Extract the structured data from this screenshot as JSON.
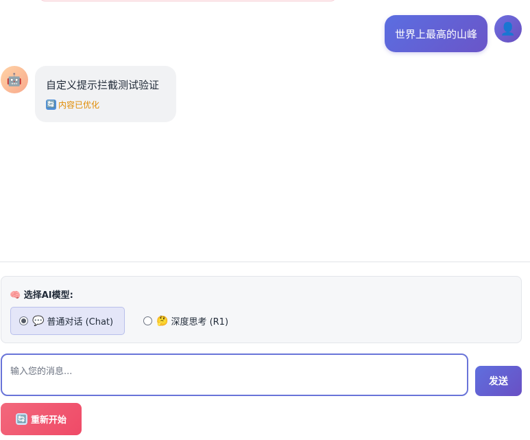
{
  "chat": {
    "messages": [
      {
        "role": "user",
        "text": "世界上最高的山峰",
        "avatar_icon": "👤"
      },
      {
        "role": "bot",
        "text": "自定义提示拦截测试验证",
        "avatar_icon": "🤖",
        "tag": {
          "icon": "🔄",
          "text": "内容已优化",
          "color": "#e08a00"
        }
      }
    ]
  },
  "model_selector": {
    "title": "🧠 选择AI模型:",
    "options": [
      {
        "emoji": "💬",
        "label": "普通对话 (Chat)",
        "selected": true
      },
      {
        "emoji": "🤔",
        "label": "深度思考 (R1)",
        "selected": false
      }
    ]
  },
  "composer": {
    "placeholder": "输入您的消息...",
    "value": "",
    "send_label": "发送"
  },
  "restart": {
    "icon": "🔄",
    "label": "重新开始"
  },
  "colors": {
    "accent": "#6a5fd6",
    "restart": "#ef4a67",
    "tag": "#e08a00"
  }
}
